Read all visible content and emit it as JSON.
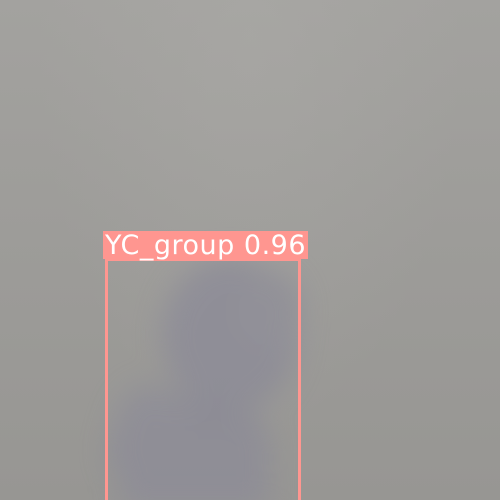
{
  "detection": {
    "class_label": "YC_group",
    "confidence": "0.96",
    "box_color": "#ff9690",
    "label_text_color": "#ffffff"
  },
  "scene": {
    "background_color": "#9e9d9a",
    "subject_color": "#8c8b97"
  }
}
